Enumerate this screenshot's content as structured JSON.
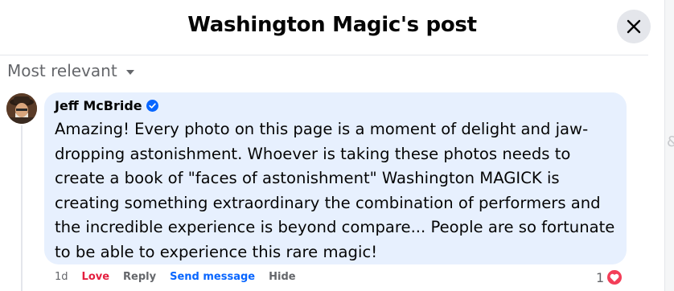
{
  "dialog": {
    "title": "Washington Magic's post",
    "close_icon": "close-icon"
  },
  "sort": {
    "label": "Most relevant",
    "icon": "caret-down-icon"
  },
  "comment": {
    "author": "Jeff McBride",
    "verified_icon": "verified-badge-icon",
    "text": "Amazing! Every photo on this page is a moment of delight and jaw-\ndropping astonishment. Whoever is taking these photos needs to\ncreate a book of \"faces of astonishment\" Washington MAGICK is\ncreating something extraordinary the combination of performers and\nthe incredible experience is beyond compare... People are so fortunate\nto be able to experience this rare magic!",
    "time": "1d",
    "reaction_label": "Love",
    "reply_label": "Reply",
    "send_message_label": "Send message",
    "hide_label": "Hide",
    "reaction_count": "1",
    "reaction_icon": "heart-icon"
  },
  "colors": {
    "love": "#e41e3f",
    "link": "#0866ff",
    "bubble": "#e7f0fe",
    "heart": "#f33e58"
  },
  "scroll_edge_glyph": "&"
}
